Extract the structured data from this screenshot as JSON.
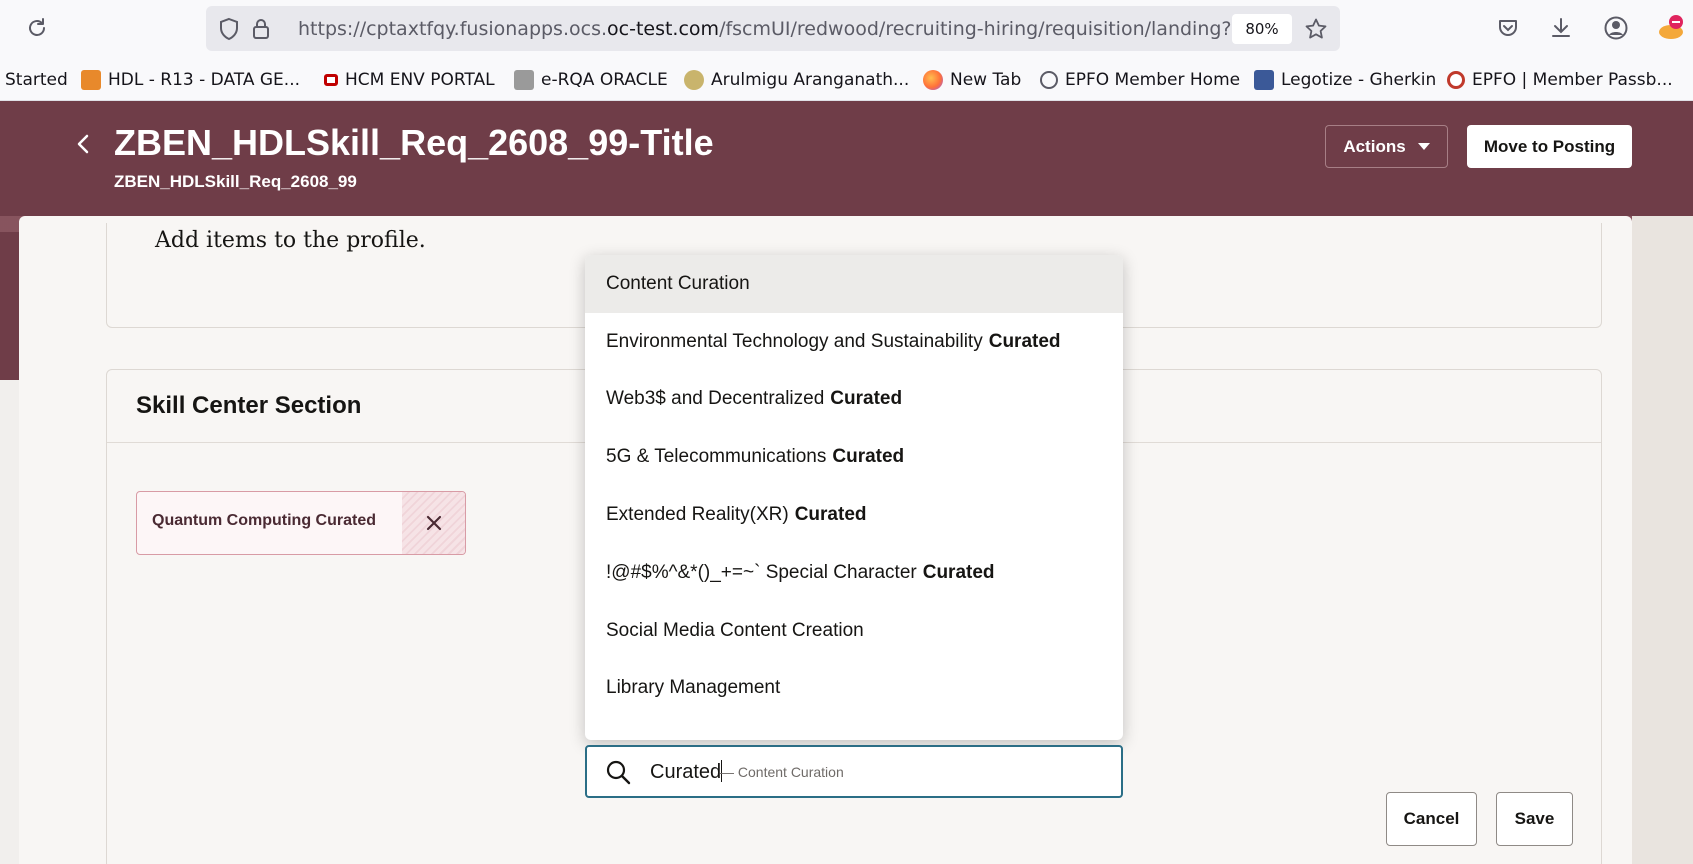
{
  "browser": {
    "url_prefix": "https://cptaxtfqy.fusionapps.ocs.",
    "url_domain": "oc-test.com",
    "url_path": "/fscmUI/redwood/recruiting-hiring/requisition/landing?re",
    "zoom": "80%",
    "bookmarks": [
      {
        "label": "Started",
        "color": ""
      },
      {
        "label": "HDL - R13 - DATA GE...",
        "color": "#e8892b"
      },
      {
        "label": "HCM ENV PORTAL",
        "color": "#c00000"
      },
      {
        "label": "e-RQA ORACLE",
        "color": "#8b8b8b"
      },
      {
        "label": "Arulmigu Aranganath...",
        "color": "#b8a25a"
      },
      {
        "label": "New Tab",
        "color": "#ff7139"
      },
      {
        "label": "EPFO Member Home",
        "color": "#5b5b66"
      },
      {
        "label": "Legotize - Gherkin",
        "color": "#3b5998"
      },
      {
        "label": "EPFO | Member Passb...",
        "color": "#c0392b"
      }
    ]
  },
  "header": {
    "title": "ZBEN_HDLSkill_Req_2608_99-Title",
    "subtitle": "ZBEN_HDLSkill_Req_2608_99",
    "actions_label": "Actions",
    "move_label": "Move to Posting"
  },
  "profile_card": {
    "text": "Add items to the profile."
  },
  "skill_section": {
    "title": "Skill Center Section",
    "chip_label": "Quantum Computing Curated",
    "cancel_label": "Cancel",
    "save_label": "Save"
  },
  "dropdown": {
    "items": [
      {
        "text": "Content Curation",
        "bold": ""
      },
      {
        "text": "Environmental Technology and Sustainability",
        "bold": "Curated"
      },
      {
        "text": "Web3$ and Decentralized",
        "bold": "Curated"
      },
      {
        "text": "5G & Telecommunications",
        "bold": "Curated"
      },
      {
        "text": "Extended Reality(XR)",
        "bold": "Curated"
      },
      {
        "text": "!@#$%^&*()_+=~` Special Character",
        "bold": "Curated"
      },
      {
        "text": "Social Media Content Creation",
        "bold": ""
      },
      {
        "text": "Library Management",
        "bold": ""
      }
    ]
  },
  "search": {
    "value": "Curated",
    "hint": "— Content Curation"
  }
}
